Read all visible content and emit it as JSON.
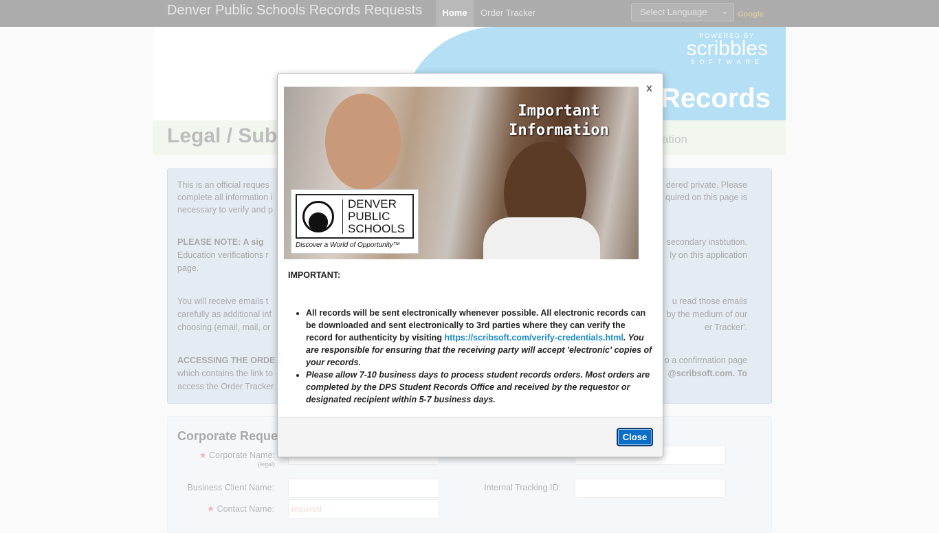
{
  "nav": {
    "brand": "Denver Public Schools Records Requests",
    "home": "Home",
    "order_tracker": "Order Tracker",
    "language": "Select Language",
    "google": "Google"
  },
  "banner": {
    "powered_by": "POWERED BY",
    "scribbles": "scribbles",
    "software": "SOFTWARE",
    "records": "Records"
  },
  "title": {
    "left": "Legal / Sub",
    "right": "ation"
  },
  "info": {
    "left": [
      "This is an official reques",
      "complete all information i",
      "necessary to verify and p",
      "PLEASE NOTE:  A sig",
      " Education verifications r",
      "page.",
      "You will receive emails t",
      "carefully as additional inf",
      "choosing (email, mail, or",
      "ACCESSING THE ORDE",
      "which contains the link to",
      "access the Order Tracker"
    ],
    "right": [
      "dered private. Please",
      "quired on this page is",
      "secondary institution.",
      "ly on this application",
      "u read those emails",
      "by the medium of our",
      "er Tracker'.",
      "o a confirmation page",
      "@scribsoft.com. To"
    ]
  },
  "corporate": {
    "heading": "Corporate Reque",
    "corporate_name": "Corporate Name:",
    "legal": "(legal)",
    "business_client": "Business Client Name:",
    "internal_tracking": "Internal Tracking ID:",
    "contact_name": "Contact Name:",
    "required": "required"
  },
  "modal": {
    "close_x": "x",
    "image_title_1": "Important",
    "image_title_2": "Information",
    "logo_line1": "DENVER",
    "logo_line2": "PUBLIC",
    "logo_line3": "SCHOOLS",
    "logo_tagline": "Discover a World of Opportunity™",
    "important": "IMPORTANT:",
    "bullet1_a": "All records will be sent electronically whenever possible.  All electronic records can be downloaded and sent electronically to 3rd parties where they can verify the record for authenticity by visiting ",
    "bullet1_link": "https://scribsoft.com/verify-credentials.html",
    "bullet1_b": ". You are responsible for ensuring that the receiving party will accept 'electronic' copies of your records.",
    "bullet2": "Please allow 7-10 business days to process student records orders.  Most orders are completed by the DPS Student Records Office and received by the requestor or designated recipient within 5-7 business days.",
    "close_button": "Close"
  },
  "colors": {
    "link": "#1a8ac8",
    "button": "#0b6fc7",
    "banner": "#b4dff4"
  }
}
